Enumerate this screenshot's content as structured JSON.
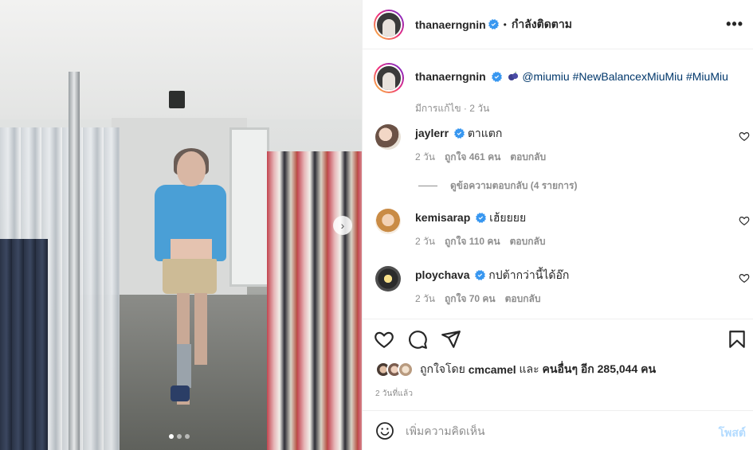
{
  "post": {
    "author": "thanaerngnin",
    "follow_sep": "•",
    "follow_label": "กำลังติดตาม",
    "more_label": "•••",
    "caption": {
      "mention": "@miumiu",
      "tags": "#NewBalancexMiuMiu #MiuMiu",
      "meta": "มีการแก้ไข · 2 วัน"
    },
    "media": {
      "next_label": "›",
      "dots": 3,
      "active_dot": 0
    }
  },
  "comments": [
    {
      "user": "jaylerr",
      "text": "ตาแตก",
      "time": "2 วัน",
      "likes": "ถูกใจ 461 คน",
      "reply": "ตอบกลับ"
    },
    {
      "user": "kemisarap",
      "text": "เฮ้ยยยย",
      "time": "2 วัน",
      "likes": "ถูกใจ 110 คน",
      "reply": "ตอบกลับ"
    },
    {
      "user": "ploychava",
      "text": "กปต้ากว่านี้ได้อ๊ก",
      "time": "2 วัน",
      "likes": "ถูกใจ 70 คน",
      "reply": "ตอบกลับ"
    }
  ],
  "view_replies": "ดูข้อความตอบกลับ (4 รายการ)",
  "likes_summary": {
    "prefix": "ถูกใจโดย",
    "user": "cmcamel",
    "middle": "และ",
    "others": "คนอื่นๆ อีก 285,044 คน"
  },
  "time_ago": "2 วันที่แล้ว",
  "composer": {
    "placeholder": "เพิ่มความคิดเห็น",
    "post_label": "โพสต์"
  },
  "colors": {
    "verified": "#3897f0",
    "link": "#00376b",
    "muted": "#8e8e8e",
    "post_disabled": "#b3dbff"
  }
}
